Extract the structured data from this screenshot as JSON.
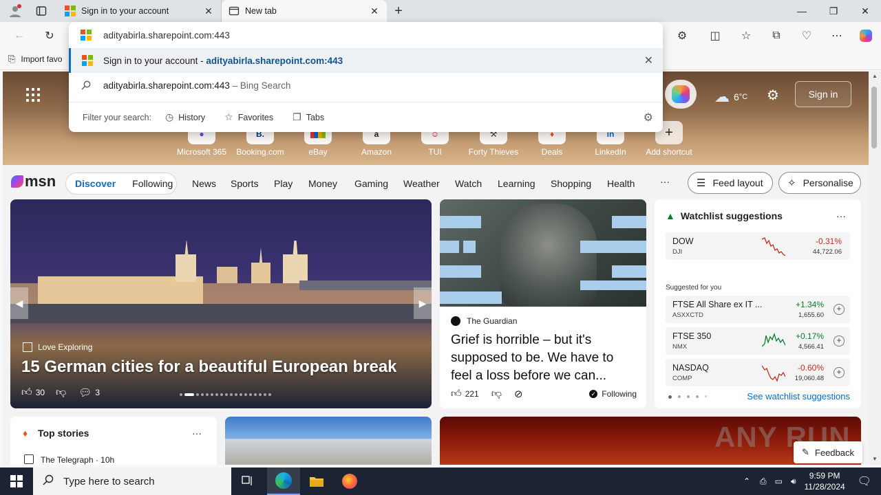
{
  "browser": {
    "tabs": [
      {
        "title": "Sign in to your account",
        "active": false
      },
      {
        "title": "New tab",
        "active": true
      }
    ],
    "favorites_label": "Import favo"
  },
  "omnibox": {
    "input_value": "adityabirla.sharepoint.com:443",
    "suggestion_title": "Sign in to your account",
    "suggestion_separator": " - ",
    "suggestion_domain": "adityabirla.sharepoint.com:443",
    "bing_query": "adityabirla.sharepoint.com:443",
    "bing_label": " – Bing Search",
    "filter_label": "Filter your search:",
    "filters": [
      "History",
      "Favorites",
      "Tabs"
    ]
  },
  "newtab": {
    "weather": "6",
    "weather_unit": "°C",
    "signin_label": "Sign in",
    "shortcuts": [
      {
        "label": "Microsoft 365",
        "tile": "",
        "color": "#7b3fe4"
      },
      {
        "label": "Booking.com",
        "tile": "B.",
        "color": "#003580"
      },
      {
        "label": "eBay",
        "tile": "",
        "color": "#e53238"
      },
      {
        "label": "Amazon",
        "tile": "a",
        "color": "#222222"
      },
      {
        "label": "TUI",
        "tile": "",
        "color": "#d40e14"
      },
      {
        "label": "Forty Thieves",
        "tile": "⚒",
        "color": "#333333"
      },
      {
        "label": "Deals",
        "tile": "♦",
        "color": "#e8541a"
      },
      {
        "label": "LinkedIn",
        "tile": "in",
        "color": "#0a66c2"
      },
      {
        "label": "Add shortcut",
        "tile": "+",
        "color": "#222222"
      }
    ]
  },
  "msn": {
    "logo": "msn",
    "pill": [
      "Discover",
      "Following"
    ],
    "nav": [
      "News",
      "Sports",
      "Play",
      "Money",
      "Gaming",
      "Weather",
      "Watch",
      "Learning",
      "Shopping",
      "Health"
    ],
    "more": "···",
    "feed_layout": "Feed layout",
    "personalise": "Personalise"
  },
  "main_card": {
    "source": "Love Exploring",
    "headline": "15 German cities for a beautiful European break",
    "likes": "30",
    "comments": "3"
  },
  "guardian_card": {
    "source": "The Guardian",
    "headline": "Grief is horrible – but it's supposed to be. We have to feel a loss before we can...",
    "likes": "221",
    "following": "Following"
  },
  "watchlist": {
    "title": "Watchlist suggestions",
    "more": "···",
    "top": {
      "symbol": "DOW",
      "exchange": "DJI",
      "change": "-0.31%",
      "price": "44,722.06"
    },
    "suggested_label": "Suggested for you",
    "items": [
      {
        "symbol": "FTSE All Share ex IT ...",
        "exchange": "ASXXCTD",
        "change": "+1.34%",
        "price": "1,655.60",
        "dir": "pos"
      },
      {
        "symbol": "FTSE 350",
        "exchange": "NMX",
        "change": "+0.17%",
        "price": "4,566.41",
        "dir": "pos"
      },
      {
        "symbol": "NASDAQ",
        "exchange": "COMP",
        "change": "-0.60%",
        "price": "19,060.48",
        "dir": "neg"
      }
    ],
    "see_more": "See watchlist suggestions"
  },
  "top_stories": {
    "title": "Top stories",
    "more": "···",
    "first_source": "The Telegraph · 10h"
  },
  "feedback_label": "Feedback",
  "watermark": "ANY RUN",
  "taskbar": {
    "search_placeholder": "Type here to search",
    "time": "9:59 PM",
    "date": "11/28/2024"
  }
}
